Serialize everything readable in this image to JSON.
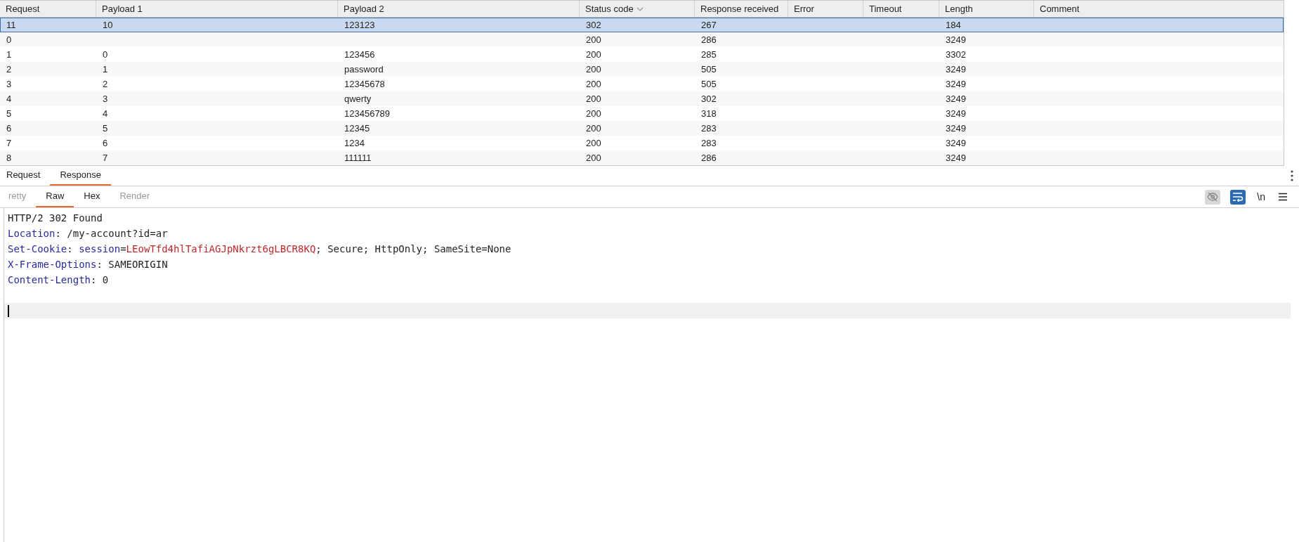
{
  "table": {
    "columns": [
      {
        "label": "Request",
        "sorted": false
      },
      {
        "label": "Payload 1",
        "sorted": false
      },
      {
        "label": "Payload 2",
        "sorted": false
      },
      {
        "label": "Status code",
        "sorted": true
      },
      {
        "label": "Response received",
        "sorted": false
      },
      {
        "label": "Error",
        "sorted": false
      },
      {
        "label": "Timeout",
        "sorted": false
      },
      {
        "label": "Length",
        "sorted": false
      },
      {
        "label": "Comment",
        "sorted": false
      }
    ],
    "rows": [
      {
        "selected": true,
        "cells": [
          "11",
          "10",
          "123123",
          "302",
          "267",
          "",
          "",
          "184",
          ""
        ]
      },
      {
        "selected": false,
        "cells": [
          "0",
          "",
          "",
          "200",
          "286",
          "",
          "",
          "3249",
          ""
        ]
      },
      {
        "selected": false,
        "cells": [
          "1",
          "0",
          "123456",
          "200",
          "285",
          "",
          "",
          "3302",
          ""
        ]
      },
      {
        "selected": false,
        "cells": [
          "2",
          "1",
          "password",
          "200",
          "505",
          "",
          "",
          "3249",
          ""
        ]
      },
      {
        "selected": false,
        "cells": [
          "3",
          "2",
          "12345678",
          "200",
          "505",
          "",
          "",
          "3249",
          ""
        ]
      },
      {
        "selected": false,
        "cells": [
          "4",
          "3",
          "qwerty",
          "200",
          "302",
          "",
          "",
          "3249",
          ""
        ]
      },
      {
        "selected": false,
        "cells": [
          "5",
          "4",
          "123456789",
          "200",
          "318",
          "",
          "",
          "3249",
          ""
        ]
      },
      {
        "selected": false,
        "cells": [
          "6",
          "5",
          "12345",
          "200",
          "283",
          "",
          "",
          "3249",
          ""
        ]
      },
      {
        "selected": false,
        "cells": [
          "7",
          "6",
          "1234",
          "200",
          "283",
          "",
          "",
          "3249",
          ""
        ]
      },
      {
        "selected": false,
        "cells": [
          "8",
          "7",
          "111111",
          "200",
          "286",
          "",
          "",
          "3249",
          ""
        ]
      }
    ]
  },
  "tabs": [
    {
      "label": "Request",
      "selected": false
    },
    {
      "label": "Response",
      "selected": true
    }
  ],
  "view_tabs": [
    {
      "label": "retty",
      "selected": false,
      "disabled": true
    },
    {
      "label": "Raw",
      "selected": true,
      "disabled": false
    },
    {
      "label": "Hex",
      "selected": false,
      "disabled": false
    },
    {
      "label": "Render",
      "selected": false,
      "disabled": true
    }
  ],
  "toolbar": [
    {
      "kind": "eye",
      "on": false
    },
    {
      "kind": "wrap",
      "on": true
    },
    {
      "kind": "newline",
      "text": "\\n",
      "on": false
    },
    {
      "kind": "menu",
      "on": false
    }
  ],
  "editor": {
    "lines": [
      [
        {
          "kind": "plain",
          "text": "HTTP/2 302 Found"
        }
      ],
      [
        {
          "kind": "name",
          "text": "Location"
        },
        {
          "kind": "plain",
          "text": ": /my-account?id=ar"
        }
      ],
      [
        {
          "kind": "name",
          "text": "Set-Cookie"
        },
        {
          "kind": "plain",
          "text": ": "
        },
        {
          "kind": "name",
          "text": "session"
        },
        {
          "kind": "plain",
          "text": "="
        },
        {
          "kind": "value",
          "text": "LEowTfd4hlTafiAGJpNkrzt6gLBCR8KQ"
        },
        {
          "kind": "plain",
          "text": "; Secure; HttpOnly; SameSite=None"
        }
      ],
      [
        {
          "kind": "name",
          "text": "X-Frame-Options"
        },
        {
          "kind": "plain",
          "text": ": SAMEORIGIN"
        }
      ],
      [
        {
          "kind": "name",
          "text": "Content-Length"
        },
        {
          "kind": "plain",
          "text": ": 0"
        }
      ]
    ],
    "cursor_visible": true
  }
}
